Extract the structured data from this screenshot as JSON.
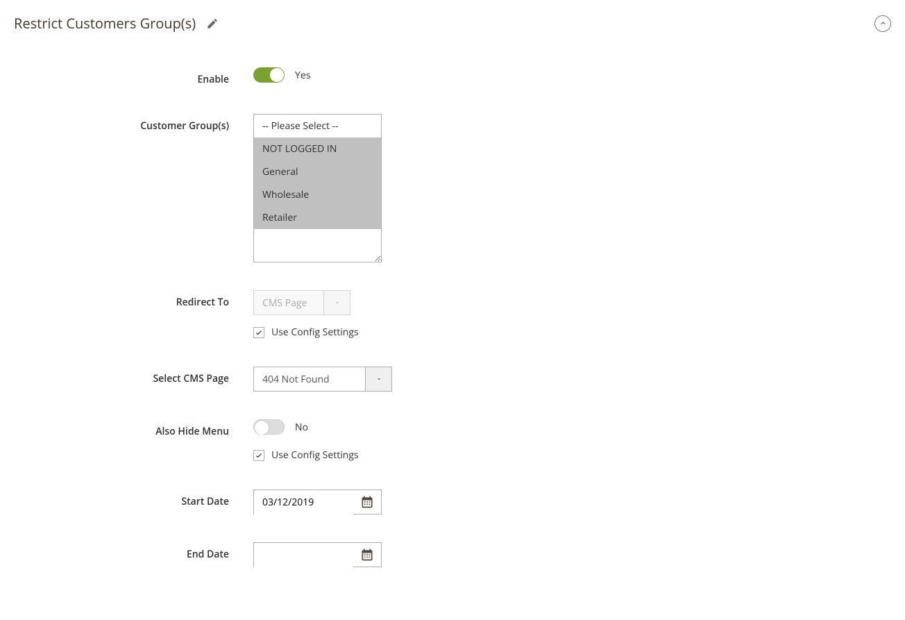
{
  "section": {
    "title": "Restrict Customers Group(s)"
  },
  "labels": {
    "enable": "Enable",
    "customer_groups": "Customer Group(s)",
    "redirect_to": "Redirect To",
    "select_cms_page": "Select CMS Page",
    "also_hide_menu": "Also Hide Menu",
    "start_date": "Start Date",
    "end_date": "End Date"
  },
  "enable": {
    "value_text": "Yes"
  },
  "customer_groups": {
    "options": [
      "-- Please Select --",
      "NOT LOGGED IN",
      "General",
      "Wholesale",
      "Retailer"
    ]
  },
  "redirect_to": {
    "value": "CMS Page",
    "use_config_label": "Use Config Settings"
  },
  "select_cms_page": {
    "value": "404 Not Found"
  },
  "also_hide_menu": {
    "value_text": "No",
    "use_config_label": "Use Config Settings"
  },
  "start_date": {
    "value": "03/12/2019"
  },
  "end_date": {
    "value": ""
  }
}
